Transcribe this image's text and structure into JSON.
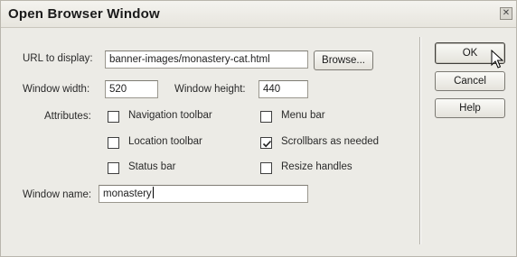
{
  "dialog": {
    "title": "Open Browser Window",
    "close_glyph": "✕"
  },
  "form": {
    "url_label": "URL to display:",
    "url_value": "banner-images/monastery-cat.html",
    "browse_label": "Browse...",
    "width_label": "Window width:",
    "width_value": "520",
    "height_label": "Window height:",
    "height_value": "440",
    "attributes_label": "Attributes:",
    "attributes": [
      {
        "label": "Navigation toolbar",
        "checked": false
      },
      {
        "label": "Menu bar",
        "checked": false
      },
      {
        "label": "Location toolbar",
        "checked": false
      },
      {
        "label": "Scrollbars as needed",
        "checked": true
      },
      {
        "label": "Status bar",
        "checked": false
      },
      {
        "label": "Resize handles",
        "checked": false
      }
    ],
    "name_label": "Window name:",
    "name_value": "monastery"
  },
  "buttons": {
    "ok": "OK",
    "cancel": "Cancel",
    "help": "Help"
  },
  "icons": {
    "checkmark": "checkmark-icon",
    "cursor": "mouse-pointer-icon",
    "close": "close-icon"
  }
}
